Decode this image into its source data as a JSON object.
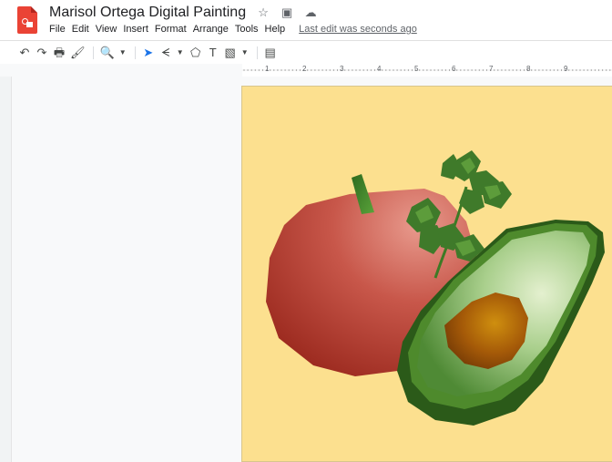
{
  "app": {
    "logo": "google-slides-logo"
  },
  "document": {
    "title": "Marisol Ortega Digital Painting",
    "title_icons": [
      "star-icon",
      "move-to-folder-icon",
      "cloud-saved-icon"
    ]
  },
  "menu": {
    "items": [
      "File",
      "Edit",
      "View",
      "Insert",
      "Format",
      "Arrange",
      "Tools",
      "Help"
    ],
    "last_edit": "Last edit was seconds ago"
  },
  "toolbar": {
    "icons": [
      "undo-icon",
      "redo-icon",
      "print-icon",
      "paint-format-icon",
      "zoom-icon",
      "select-icon",
      "line-icon",
      "shape-icon",
      "text-box-icon",
      "image-icon",
      "comment-icon"
    ]
  },
  "ruler": {
    "labels": [
      "1",
      "2",
      "3",
      "4",
      "5",
      "6",
      "7",
      "8",
      "9"
    ]
  },
  "colors": {
    "slide_background": "#fce08f",
    "tomato": "#c94a3a",
    "avocado_skin": "#2e5f1c",
    "avocado_flesh": "#8fbf6e",
    "avocado_pit": "#a35a07",
    "cilantro": "#3f7a2a"
  }
}
